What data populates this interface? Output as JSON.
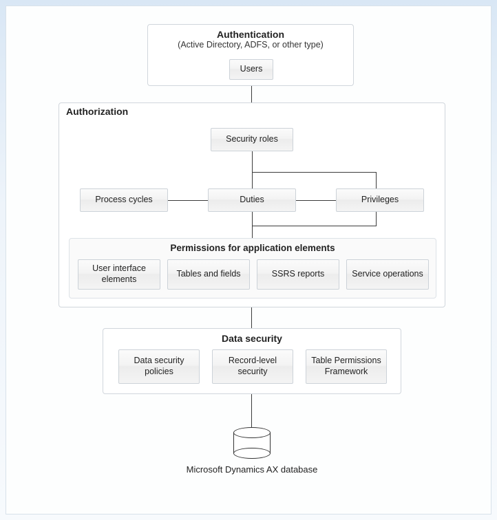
{
  "auth_panel": {
    "title": "Authentication",
    "subtitle": "(Active Directory, ADFS, or other type)",
    "users_box": "Users"
  },
  "authz_panel": {
    "title": "Authorization",
    "security_roles": "Security roles",
    "process_cycles": "Process cycles",
    "duties": "Duties",
    "privileges": "Privileges",
    "permissions_panel": {
      "title": "Permissions for application elements",
      "items": {
        "ui": "User interface elements",
        "tables": "Tables and fields",
        "ssrs": "SSRS reports",
        "service": "Service operations"
      }
    }
  },
  "data_sec_panel": {
    "title": "Data security",
    "policies": "Data security policies",
    "record": "Record-level security",
    "table_perm": "Table Permissions Framework"
  },
  "database_label": "Microsoft Dynamics AX database"
}
